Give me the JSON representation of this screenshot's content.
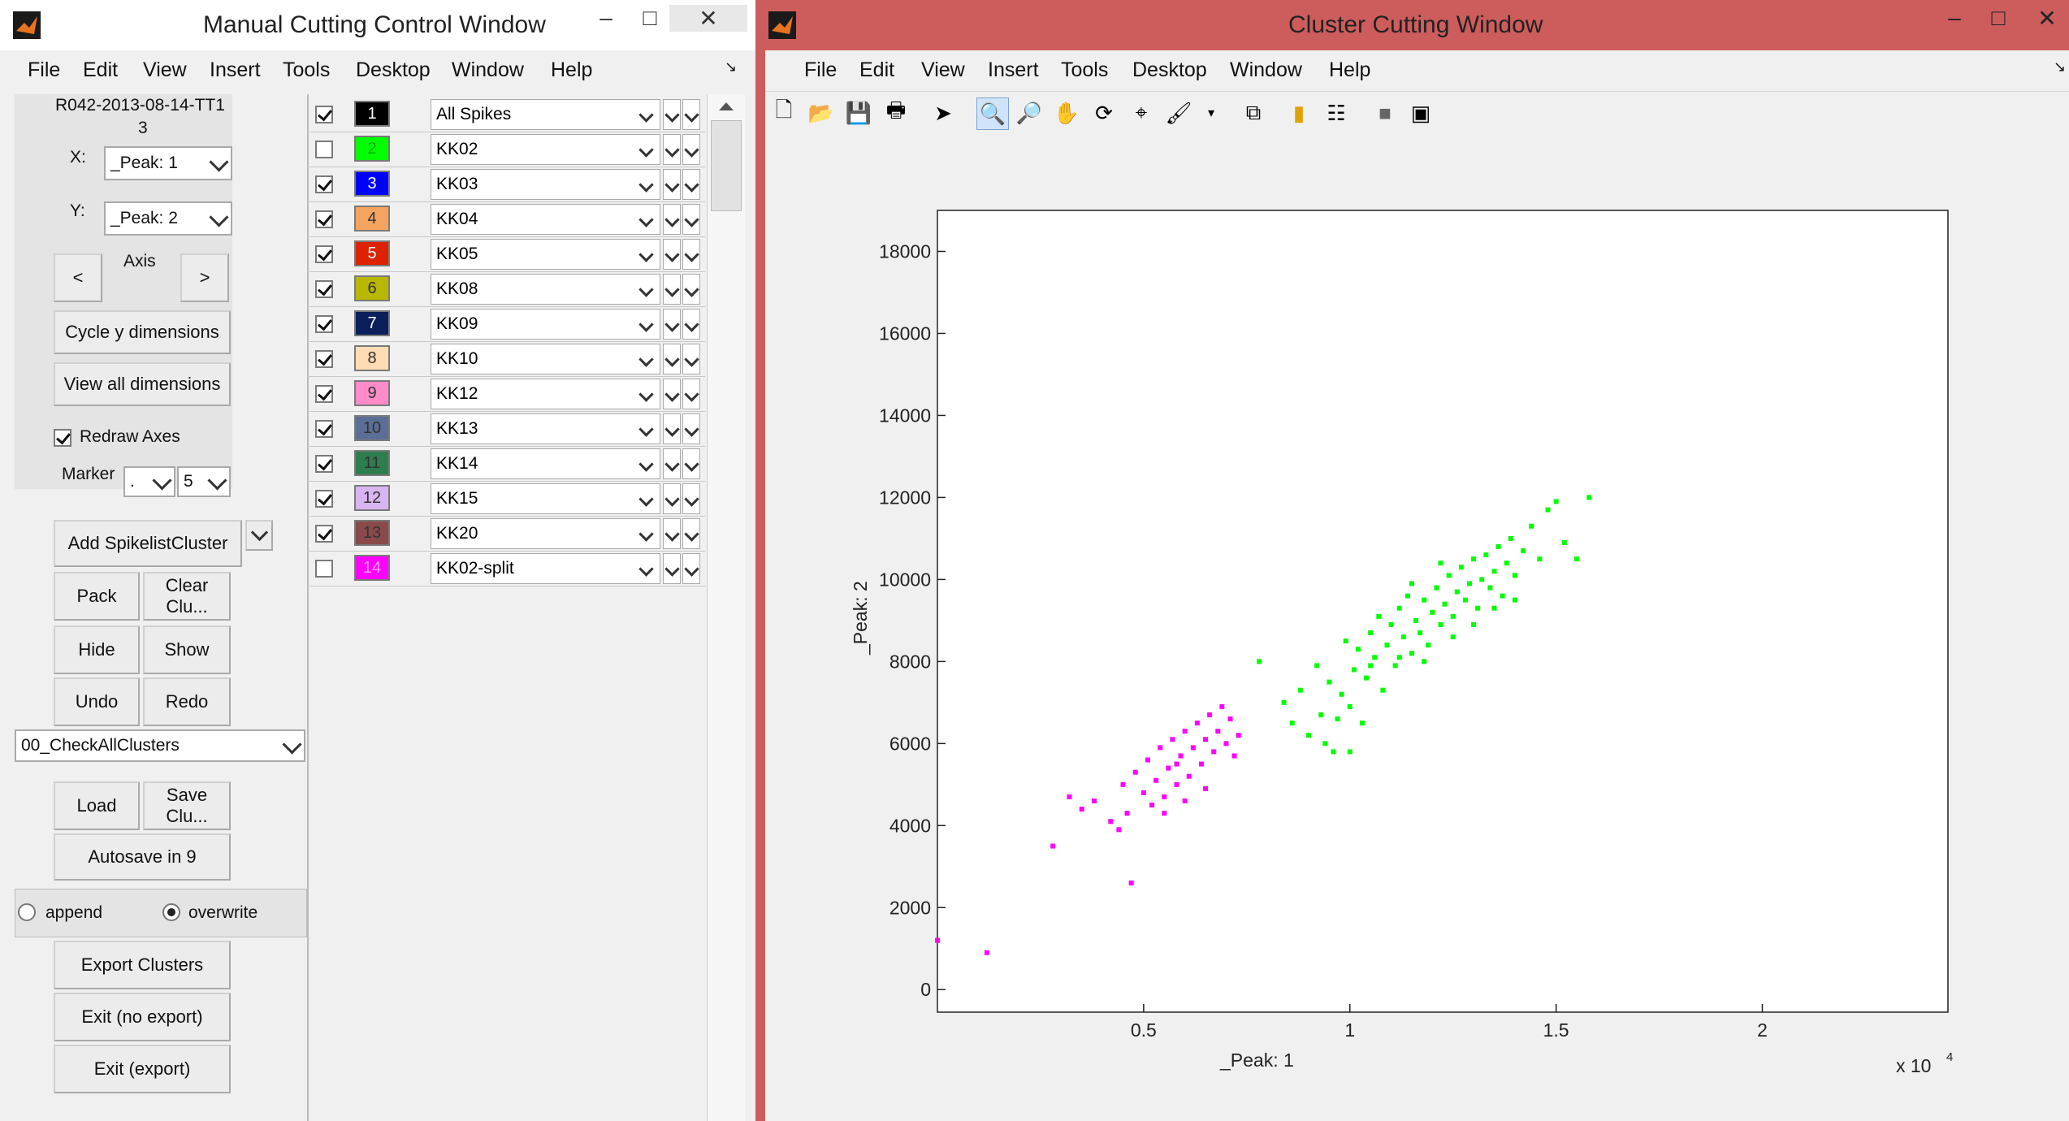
{
  "left_window": {
    "title": "Manual Cutting Control Window",
    "menu": [
      "File",
      "Edit",
      "View",
      "Insert",
      "Tools",
      "Desktop",
      "Window",
      "Help"
    ],
    "session_label_line1": "R042-2013-08-14-TT1",
    "session_label_line2": "3",
    "x_label": "X:",
    "x_value": "_Peak: 1",
    "y_label": "Y:",
    "y_value": "_Peak: 2",
    "axis_label": "Axis",
    "prev_label": "<",
    "next_label": ">",
    "cycle_y": "Cycle y dimensions",
    "view_all": "View all dimensions",
    "redraw_axes": "Redraw Axes",
    "marker_label": "Marker",
    "marker_value": ".",
    "marker_size": "5",
    "add_cluster": "Add SpikelistCluster",
    "pack": "Pack",
    "clear": "Clear Clu...",
    "hide": "Hide",
    "show": "Show",
    "undo": "Undo",
    "redo": "Redo",
    "check_select": "00_CheckAllClusters",
    "load": "Load",
    "save": "Save Clu...",
    "autosave": "Autosave in 9",
    "append": "append",
    "overwrite": "overwrite",
    "export": "Export Clusters",
    "exit_no_export": "Exit (no export)",
    "exit_export": "Exit (export)"
  },
  "clusters": [
    {
      "num": "1",
      "name": "All Spikes",
      "checked": true,
      "color": "#000000",
      "text": "#ffffff"
    },
    {
      "num": "2",
      "name": "KK02",
      "checked": false,
      "color": "#00ff00",
      "text": "#00aa00"
    },
    {
      "num": "3",
      "name": "KK03",
      "checked": true,
      "color": "#0000ff",
      "text": "#ffffff"
    },
    {
      "num": "4",
      "name": "KK04",
      "checked": true,
      "color": "#f4a460",
      "text": "#333333"
    },
    {
      "num": "5",
      "name": "KK05",
      "checked": true,
      "color": "#dd2200",
      "text": "#ffffff"
    },
    {
      "num": "6",
      "name": "KK08",
      "checked": true,
      "color": "#b8b800",
      "text": "#333333"
    },
    {
      "num": "7",
      "name": "KK09",
      "checked": true,
      "color": "#0a1f5c",
      "text": "#ffffff"
    },
    {
      "num": "8",
      "name": "KK10",
      "checked": true,
      "color": "#ffdcb4",
      "text": "#333333"
    },
    {
      "num": "9",
      "name": "KK12",
      "checked": true,
      "color": "#ff8cc8",
      "text": "#333333"
    },
    {
      "num": "10",
      "name": "KK13",
      "checked": true,
      "color": "#5a6e96",
      "text": "#333333"
    },
    {
      "num": "11",
      "name": "KK14",
      "checked": true,
      "color": "#2e7d4f",
      "text": "#333333"
    },
    {
      "num": "12",
      "name": "KK15",
      "checked": true,
      "color": "#d8b4f0",
      "text": "#333333"
    },
    {
      "num": "13",
      "name": "KK20",
      "checked": true,
      "color": "#8b4a4a",
      "text": "#333333"
    },
    {
      "num": "14",
      "name": "KK02-split",
      "checked": false,
      "color": "#ff00ff",
      "text": "#ff99ff"
    }
  ],
  "right_window": {
    "title": "Cluster Cutting Window",
    "menu": [
      "File",
      "Edit",
      "View",
      "Insert",
      "Tools",
      "Desktop",
      "Window",
      "Help"
    ]
  },
  "chart_data": {
    "type": "scatter",
    "xlabel": "_Peak: 1",
    "ylabel": "_Peak: 2",
    "x_multiplier": "x 10",
    "x_exponent": "4",
    "xlim": [
      0,
      2.45
    ],
    "ylim": [
      -550,
      19000
    ],
    "xticks": [
      "0.5",
      "1",
      "1.5",
      "2"
    ],
    "yticks": [
      "0",
      "2000",
      "4000",
      "6000",
      "8000",
      "10000",
      "12000",
      "14000",
      "16000",
      "18000"
    ],
    "series": [
      {
        "color": "#00ff00",
        "points": [
          [
            0.78,
            8000
          ],
          [
            0.84,
            7000
          ],
          [
            0.86,
            6500
          ],
          [
            0.88,
            7300
          ],
          [
            0.9,
            6200
          ],
          [
            0.92,
            7900
          ],
          [
            0.93,
            6700
          ],
          [
            0.95,
            7500
          ],
          [
            0.96,
            5800
          ],
          [
            0.97,
            6600
          ],
          [
            0.98,
            7200
          ],
          [
            0.99,
            8500
          ],
          [
            1.0,
            6900
          ],
          [
            1.01,
            7800
          ],
          [
            1.02,
            8300
          ],
          [
            1.03,
            6500
          ],
          [
            1.04,
            7600
          ],
          [
            1.05,
            8700
          ],
          [
            1.06,
            8100
          ],
          [
            1.07,
            9100
          ],
          [
            1.08,
            7300
          ],
          [
            1.09,
            8400
          ],
          [
            1.1,
            8900
          ],
          [
            1.11,
            7900
          ],
          [
            1.12,
            9300
          ],
          [
            1.13,
            8600
          ],
          [
            1.14,
            9600
          ],
          [
            1.15,
            8200
          ],
          [
            1.16,
            9000
          ],
          [
            1.17,
            8700
          ],
          [
            1.18,
            9500
          ],
          [
            1.19,
            8400
          ],
          [
            1.2,
            9200
          ],
          [
            1.21,
            9800
          ],
          [
            1.22,
            8900
          ],
          [
            1.23,
            9400
          ],
          [
            1.24,
            10100
          ],
          [
            1.25,
            9100
          ],
          [
            1.26,
            9700
          ],
          [
            1.27,
            10300
          ],
          [
            1.28,
            9500
          ],
          [
            1.29,
            9900
          ],
          [
            1.3,
            10500
          ],
          [
            1.31,
            9300
          ],
          [
            1.32,
            10000
          ],
          [
            1.33,
            10600
          ],
          [
            1.34,
            9800
          ],
          [
            1.35,
            10200
          ],
          [
            1.36,
            10800
          ],
          [
            1.37,
            9600
          ],
          [
            1.38,
            10400
          ],
          [
            1.39,
            11000
          ],
          [
            1.4,
            10100
          ],
          [
            1.42,
            10700
          ],
          [
            1.44,
            11300
          ],
          [
            1.46,
            10500
          ],
          [
            1.48,
            11700
          ],
          [
            1.5,
            11900
          ],
          [
            1.52,
            10900
          ],
          [
            1.55,
            10500
          ],
          [
            1.58,
            12000
          ],
          [
            1.12,
            8100
          ],
          [
            1.18,
            8000
          ],
          [
            1.25,
            8600
          ],
          [
            1.3,
            8900
          ],
          [
            1.05,
            7900
          ],
          [
            1.15,
            9900
          ],
          [
            1.22,
            10400
          ],
          [
            1.35,
            9300
          ],
          [
            1.4,
            9500
          ],
          [
            0.94,
            6000
          ],
          [
            1.0,
            5800
          ]
        ]
      },
      {
        "color": "#ff00ff",
        "points": [
          [
            0.0,
            1200
          ],
          [
            0.12,
            900
          ],
          [
            0.28,
            3500
          ],
          [
            0.32,
            4700
          ],
          [
            0.35,
            4400
          ],
          [
            0.38,
            4600
          ],
          [
            0.42,
            4100
          ],
          [
            0.44,
            3900
          ],
          [
            0.45,
            5000
          ],
          [
            0.46,
            4300
          ],
          [
            0.47,
            2600
          ],
          [
            0.48,
            5300
          ],
          [
            0.5,
            4800
          ],
          [
            0.51,
            5600
          ],
          [
            0.52,
            4500
          ],
          [
            0.53,
            5100
          ],
          [
            0.54,
            5900
          ],
          [
            0.55,
            4700
          ],
          [
            0.56,
            5400
          ],
          [
            0.57,
            6100
          ],
          [
            0.58,
            5000
          ],
          [
            0.59,
            5700
          ],
          [
            0.6,
            6300
          ],
          [
            0.61,
            5200
          ],
          [
            0.62,
            5900
          ],
          [
            0.63,
            6500
          ],
          [
            0.64,
            5500
          ],
          [
            0.65,
            6100
          ],
          [
            0.66,
            6700
          ],
          [
            0.67,
            5800
          ],
          [
            0.68,
            6300
          ],
          [
            0.69,
            6900
          ],
          [
            0.7,
            6000
          ],
          [
            0.71,
            6600
          ],
          [
            0.72,
            5700
          ],
          [
            0.73,
            6200
          ],
          [
            0.55,
            4300
          ],
          [
            0.6,
            4600
          ],
          [
            0.65,
            4900
          ],
          [
            0.58,
            5500
          ]
        ]
      }
    ]
  }
}
